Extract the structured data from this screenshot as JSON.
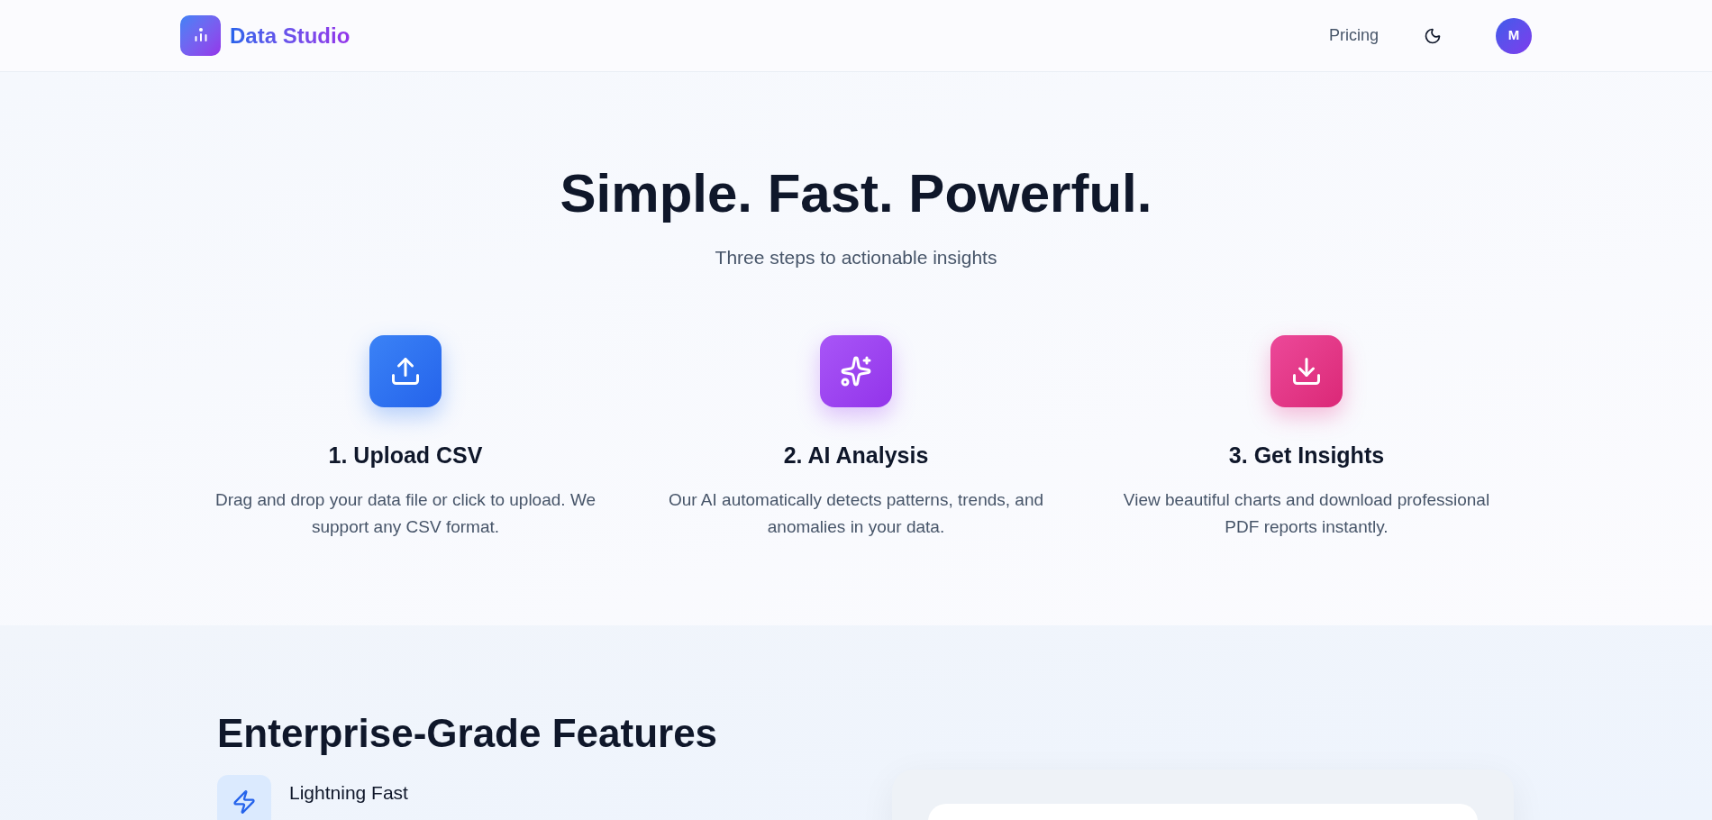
{
  "header": {
    "brand": "Data Studio",
    "nav": [
      {
        "label": "Pricing"
      }
    ],
    "avatar": "M"
  },
  "hero": {
    "title": "Simple. Fast. Powerful.",
    "subtitle": "Three steps to actionable insights",
    "steps": [
      {
        "kind": "upload",
        "title": "1. Upload CSV",
        "text": "Drag and drop your data file or click to upload. We support any CSV format."
      },
      {
        "kind": "ai",
        "title": "2. AI Analysis",
        "text": "Our AI automatically detects patterns, trends, and anomalies in your data."
      },
      {
        "kind": "download",
        "title": "3. Get Insights",
        "text": "View beautiful charts and download professional PDF reports instantly."
      }
    ]
  },
  "features": {
    "title": "Enterprise-Grade Features",
    "items": [
      {
        "kind": "bolt",
        "title": "Lightning Fast"
      }
    ]
  }
}
